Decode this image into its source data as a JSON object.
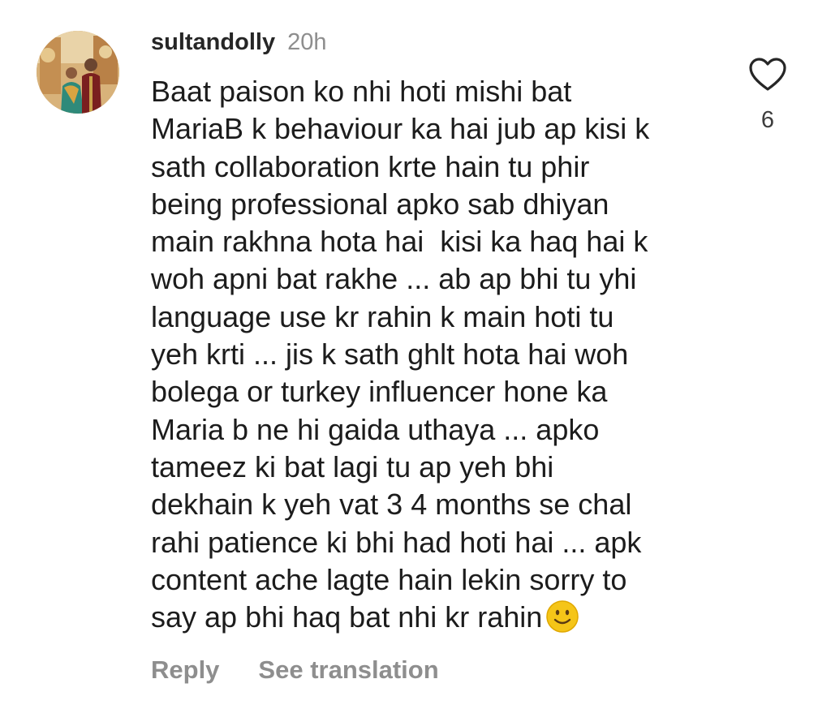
{
  "comment": {
    "username": "sultandolly",
    "time": "20h",
    "lines": [
      "Baat paison ko nhi hoti mishi bat",
      "MariaB k behaviour ka hai jub ap kisi k",
      "sath collaboration krte hain tu phir",
      "being professional apko sab dhiyan",
      "main rakhna hota hai  kisi ka haq hai k",
      "woh apni bat rakhe ... ab ap bhi tu yhi",
      "language use kr rahin k main hoti tu",
      "yeh krti ... jis k sath ghlt hota hai woh",
      "bolega or turkey influencer hone ka",
      "Maria b ne hi gaida uthaya ... apko",
      "tameez ki bat lagi tu ap yeh bhi",
      "dekhain k yeh vat 3 4 months se chal",
      "rahi patience ki bhi had hoti hai ... apk",
      "content ache lagte hain lekin sorry to",
      "say ap bhi haq bat nhi kr rahin"
    ],
    "trailing_emoji": "slightly-smiling-face",
    "like_count": "6",
    "like_icon": "heart-outline-icon",
    "actions": {
      "reply": "Reply",
      "see_translation": "See translation"
    }
  },
  "colors": {
    "username": "#262626",
    "secondary": "#8e8e8e",
    "body": "#1c1c1c",
    "emoji": "#f5c518"
  }
}
